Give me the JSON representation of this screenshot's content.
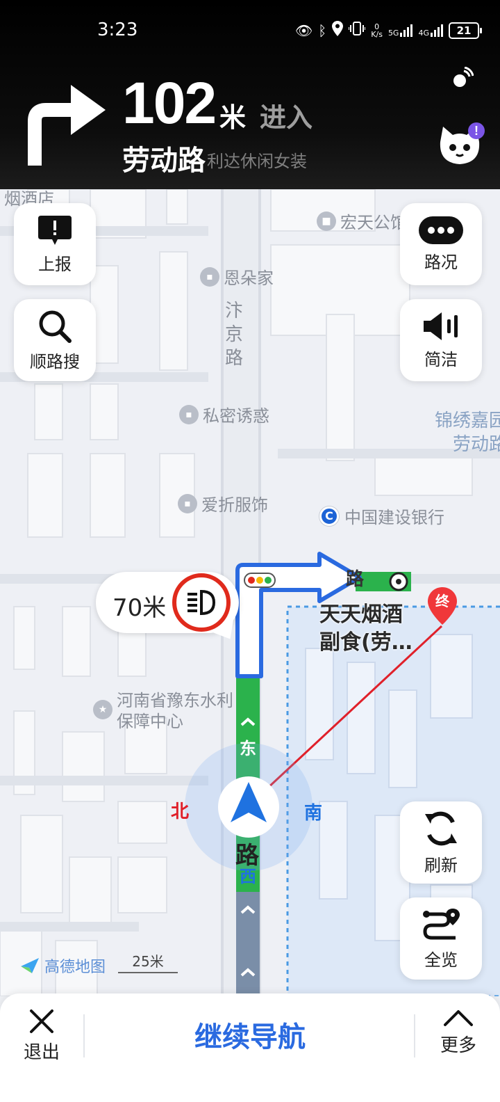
{
  "status_bar": {
    "time": "3:23",
    "net_speed_value": "0",
    "net_speed_unit": "K/s",
    "signal1": "5G",
    "signal2": "4G",
    "battery": "21"
  },
  "guidance": {
    "maneuver_icon": "turn-right-icon",
    "distance": "102",
    "distance_unit": "米",
    "action": "进入",
    "road_name": "劳动路",
    "background_shop": "利达休闲女装"
  },
  "map": {
    "pois": {
      "hongtian": "宏天公馆",
      "enduojia": "恩朵家",
      "simiyouhuo": "私密诱惑",
      "aizhefushi": "爱折服饰",
      "water_center": "河南省豫东水利保障中心",
      "yanjiudian": "烟酒店"
    },
    "road_bianjing": [
      "汴",
      "京",
      "路"
    ],
    "area_label": [
      "锦绣嘉园",
      "劳动路"
    ],
    "bank": "中国建设银行",
    "bank_icon": "bank-logo-icon",
    "destination_label": [
      "天天烟酒",
      "副食(劳…"
    ],
    "destination_marker": "终",
    "destination_road_fragment": "路",
    "compass": {
      "north": "北",
      "south": "南"
    },
    "route_side_labels": {
      "east": "东",
      "west": "西",
      "road": "路"
    },
    "brand": "高德地图",
    "scale": "25米"
  },
  "speed_camera": {
    "distance": "70米",
    "icon": "speed-camera-icon"
  },
  "buttons": {
    "report": "上报",
    "search_along": "顺路搜",
    "traffic": "路况",
    "voice": "简洁",
    "refresh": "刷新",
    "overview": "全览"
  },
  "bottom": {
    "exit": "退出",
    "continue": "继续导航",
    "more": "更多"
  },
  "colors": {
    "route_green": "#2bb24c",
    "route_blue": "#2a6ae0",
    "camera_red": "#e02a1c",
    "dest_red": "#f0373a"
  }
}
